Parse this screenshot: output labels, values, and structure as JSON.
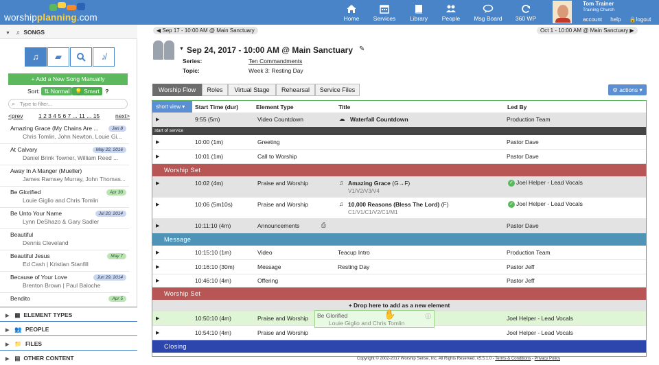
{
  "app": {
    "logo_main": "worship",
    "logo_accent": "planning",
    "logo_suffix": ".com"
  },
  "nav": [
    {
      "label": "Home",
      "icon": "home-icon"
    },
    {
      "label": "Services",
      "icon": "calendar-icon"
    },
    {
      "label": "Library",
      "icon": "book-icon"
    },
    {
      "label": "People",
      "icon": "people-icon"
    },
    {
      "label": "Msg Board",
      "icon": "chat-icon"
    },
    {
      "label": "360 WP",
      "icon": "refresh-icon"
    }
  ],
  "user": {
    "name": "Tom Trainer",
    "church": "Training Church",
    "account": "account",
    "help": "help",
    "logout": "logout"
  },
  "sidebar": {
    "songs_header": "SONGS",
    "add_song": "Add a New Song Manually",
    "sort_label": "Sort:",
    "sort_normal": "Normal",
    "sort_smart": "Smart",
    "sort_help": "?",
    "filter_placeholder": "Type to filter...",
    "prev": "<prev",
    "pages": "1 2 3 4 5 6 7 ... 11 ... 15",
    "next": "next>",
    "songs": [
      {
        "title": "Amazing Grace (My Chains Are ...",
        "authors": "Chris Tomlin, John Newton, Louie Gi...",
        "date": "Jan 8",
        "color": "blue"
      },
      {
        "title": "At Calvary",
        "authors": "Daniel Brink Towner, William Reed ...",
        "date": "May 22, 2016",
        "color": "blue"
      },
      {
        "title": "Away In A Manger (Mueller)",
        "authors": "James Ramsey Murray, John Thomas...",
        "date": "",
        "color": ""
      },
      {
        "title": "Be Glorified",
        "authors": "Louie Giglio and Chris Tomlin",
        "date": "Apr 30",
        "color": "green"
      },
      {
        "title": "Be Unto Your Name",
        "authors": "Lynn DeShazo & Gary Sadler",
        "date": "Jul 20, 2014",
        "color": "blue"
      },
      {
        "title": "Beautiful",
        "authors": "Dennis Cleveland",
        "date": "",
        "color": ""
      },
      {
        "title": "Beautiful Jesus",
        "authors": "Ed Cash | Kristian Stanfill",
        "date": "May 7",
        "color": "green"
      },
      {
        "title": "Because of Your Love",
        "authors": "Brenton Brown | Paul Baloche",
        "date": "Jun 29, 2014",
        "color": "blue"
      },
      {
        "title": "Bendito",
        "authors": "",
        "date": "Apr 5",
        "color": "green"
      }
    ],
    "sections": [
      "ELEMENT TYPES",
      "PEOPLE",
      "FILES",
      "OTHER CONTENT"
    ]
  },
  "main": {
    "prev_event": "Sep 17 - 10:00 AM @ Main Sanctuary",
    "next_event": "Oct 1 - 10:00 AM @ Main Sanctuary",
    "event_title": "Sep 24, 2017 - 10:00 AM @ Main Sanctuary",
    "series_label": "Series:",
    "series_value": "Ten Commandments",
    "topic_label": "Topic:",
    "topic_value": "Week 3: Resting Day",
    "tabs": [
      "Worship Flow",
      "Roles",
      "Virtual Stage",
      "Rehearsal",
      "Service Files"
    ],
    "actions": "actions",
    "columns": {
      "view": "short view",
      "start": "Start Time (dur)",
      "type": "Element Type",
      "title": "Title",
      "led": "Led By"
    },
    "drop_text": "+ Drop here to add as a new element",
    "drag_title": "Be Glorified",
    "drag_authors": "Louie Giglio and Chris Tomlin"
  },
  "flow": [
    {
      "kind": "row",
      "start": "9:55",
      "dur": "5m",
      "type": "Video Countdown",
      "title": "Waterfall Countdown",
      "led": "Production Team",
      "alt": true,
      "icon": "cloud-icon"
    },
    {
      "kind": "band",
      "style": "dark",
      "label": "start of service"
    },
    {
      "kind": "row",
      "start": "10:00",
      "dur": "1m",
      "type": "Greeting",
      "title": "",
      "led": "Pastor Dave",
      "alt": false
    },
    {
      "kind": "row",
      "start": "10:01",
      "dur": "1m",
      "type": "Call to Worship",
      "title": "",
      "led": "Pastor Dave",
      "alt": false
    },
    {
      "kind": "band",
      "style": "red",
      "label": "Worship Set"
    },
    {
      "kind": "song",
      "start": "10:02",
      "dur": "4m",
      "type": "Praise and Worship",
      "title": "Amazing Grace",
      "key": "(G→F)",
      "parts": "V1/V2/V3/V4",
      "led": "Joel Helper - Lead Vocals",
      "alt": true
    },
    {
      "kind": "song",
      "start": "10:06",
      "dur": "5m10s",
      "type": "Praise and Worship",
      "title": "10,000 Reasons (Bless The Lord)",
      "key": "(F)",
      "parts": "C1/V1/C1/V2/C1/M1",
      "led": "Joel Helper - Lead Vocals",
      "alt": false
    },
    {
      "kind": "row",
      "start": "10:11:10",
      "dur": "4m",
      "type": "Announcements",
      "title": "",
      "led": "Pastor Dave",
      "alt": true,
      "icon": "print-icon"
    },
    {
      "kind": "band",
      "style": "teal",
      "label": "Message"
    },
    {
      "kind": "row",
      "start": "10:15:10",
      "dur": "1m",
      "type": "Video",
      "title": "Teacup Intro",
      "led": "Production Team",
      "alt": false
    },
    {
      "kind": "row",
      "start": "10:16:10",
      "dur": "30m",
      "type": "Message",
      "title": "Resting Day",
      "led": "Pastor Jeff",
      "alt": false
    },
    {
      "kind": "row",
      "start": "10:46:10",
      "dur": "4m",
      "type": "Offering",
      "title": "",
      "led": "Pastor Jeff",
      "alt": false
    },
    {
      "kind": "band",
      "style": "red",
      "label": "Worship Set"
    },
    {
      "kind": "row",
      "start": "10:50:10",
      "dur": "4m",
      "type": "Praise and Worship",
      "title": "",
      "led": "Joel Helper - Lead Vocals",
      "alt": false,
      "drag": true
    },
    {
      "kind": "row",
      "start": "10:54:10",
      "dur": "4m",
      "type": "Praise and Worship",
      "title": "",
      "led": "Joel Helper - Lead Vocals",
      "alt": false
    },
    {
      "kind": "band",
      "style": "navy",
      "label": "Closing"
    }
  ],
  "footer": {
    "copyright": "Copyright © 2002-2017 Worship Sense, Inc. All Rights Reserved. v5.5.1.0 -",
    "terms": "Terms & Conditions",
    "sep": "-",
    "privacy": "Privacy Policy"
  },
  "colors": {
    "header": "#4a84c8",
    "accent": "#5cb85c",
    "worship_band": "#b85555",
    "message_band": "#4f93b7",
    "closing_band": "#2c46ad"
  }
}
